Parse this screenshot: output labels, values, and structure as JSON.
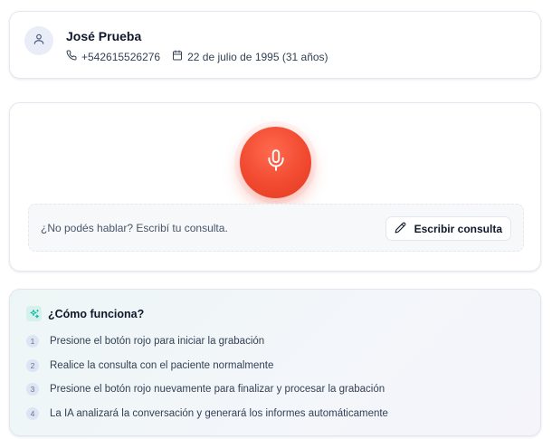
{
  "patient": {
    "avatar_icon": "user-icon",
    "name": "José Prueba",
    "phone_icon": "phone-icon",
    "phone": "+542615526276",
    "dob_icon": "calendar-icon",
    "dob": "22 de julio de 1995 (31 años)"
  },
  "recorder": {
    "mic_icon": "microphone-icon",
    "mic_color": "#f14a30",
    "write_prompt": "¿No podés hablar? Escribí tu consulta.",
    "write_button_icon": "pencil-icon",
    "write_button_label": "Escribir consulta"
  },
  "howto": {
    "icon": "sparkles-icon",
    "title": "¿Cómo funciona?",
    "steps": [
      {
        "num": "1",
        "text": "Presione el botón rojo para iniciar la grabación"
      },
      {
        "num": "2",
        "text": "Realice la consulta con el paciente normalmente"
      },
      {
        "num": "3",
        "text": "Presione el botón rojo nuevamente para finalizar y procesar la grabación"
      },
      {
        "num": "4",
        "text": "La IA analizará la conversación y generará los informes automáticamente"
      }
    ]
  }
}
